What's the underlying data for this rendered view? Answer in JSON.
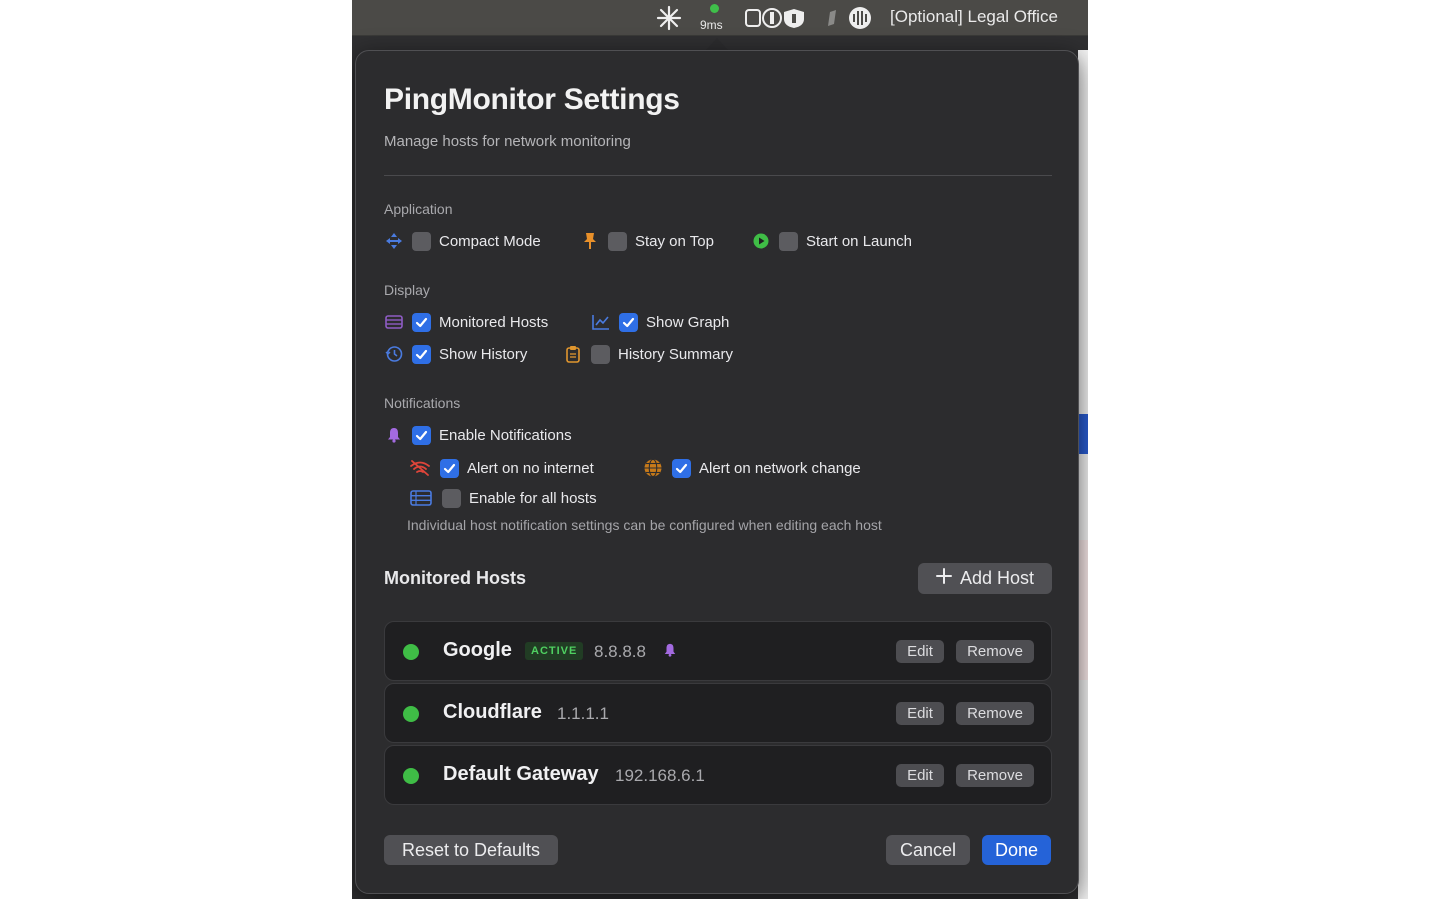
{
  "menubar": {
    "ping": "9ms",
    "title": "[Optional] Legal Office"
  },
  "panel": {
    "title": "PingMonitor Settings",
    "subtitle": "Manage hosts for network monitoring"
  },
  "application": {
    "heading": "Application",
    "options": [
      {
        "label": "Compact Mode",
        "checked": false,
        "icon": "compact-icon"
      },
      {
        "label": "Stay on Top",
        "checked": false,
        "icon": "pin-icon"
      },
      {
        "label": "Start on Launch",
        "checked": false,
        "icon": "play-icon"
      }
    ]
  },
  "display": {
    "heading": "Display",
    "options": [
      {
        "label": "Monitored Hosts",
        "checked": true,
        "icon": "list-icon"
      },
      {
        "label": "Show Graph",
        "checked": true,
        "icon": "graph-icon"
      },
      {
        "label": "Show History",
        "checked": true,
        "icon": "history-icon"
      },
      {
        "label": "History Summary",
        "checked": false,
        "icon": "clipboard-icon"
      }
    ]
  },
  "notifications": {
    "heading": "Notifications",
    "enable": {
      "label": "Enable Notifications",
      "checked": true,
      "icon": "bell-icon"
    },
    "options": [
      {
        "label": "Alert on no internet",
        "checked": true,
        "icon": "wifi-off-icon"
      },
      {
        "label": "Alert on network change",
        "checked": true,
        "icon": "globe-icon"
      },
      {
        "label": "Enable for all hosts",
        "checked": false,
        "icon": "server-icon"
      }
    ],
    "hint": "Individual host notification settings can be configured when editing each host"
  },
  "hosts": {
    "heading": "Monitored Hosts",
    "add_label": "Add Host",
    "edit_label": "Edit",
    "remove_label": "Remove",
    "items": [
      {
        "name": "Google",
        "badge": "ACTIVE",
        "ip": "8.8.8.8",
        "notify": true,
        "status_color": "#3fbd46"
      },
      {
        "name": "Cloudflare",
        "badge": "",
        "ip": "1.1.1.1",
        "notify": false,
        "status_color": "#3fbd46"
      },
      {
        "name": "Default Gateway",
        "badge": "",
        "ip": "192.168.6.1",
        "notify": false,
        "status_color": "#3fbd46"
      }
    ]
  },
  "footer": {
    "reset_label": "Reset to Defaults",
    "cancel_label": "Cancel",
    "done_label": "Done"
  },
  "colors": {
    "accent": "#2563d8",
    "status_ok": "#3fbd46"
  }
}
